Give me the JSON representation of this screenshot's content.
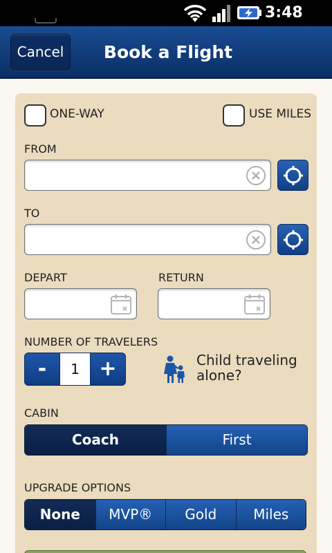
{
  "status_bar": {
    "time": "3:48 PM"
  },
  "header": {
    "cancel_label": "Cancel",
    "title": "Book a Flight"
  },
  "options": {
    "one_way_label": "ONE-WAY",
    "use_miles_label": "USE MILES"
  },
  "from": {
    "label": "FROM",
    "value": ""
  },
  "to": {
    "label": "TO",
    "value": ""
  },
  "dates": {
    "depart_label": "DEPART",
    "return_label": "RETURN"
  },
  "travelers": {
    "label": "NUMBER OF TRAVELERS",
    "minus_label": "-",
    "count": "1",
    "plus_label": "+",
    "child_line1": "Child traveling",
    "child_line2": "alone?"
  },
  "cabin": {
    "label": "CABIN",
    "options": [
      "Coach",
      "First"
    ],
    "selected": "Coach"
  },
  "upgrade": {
    "label": "UPGRADE OPTIONS",
    "options": [
      "None",
      "MVP®",
      "Gold",
      "Miles"
    ],
    "selected": "None"
  },
  "icons": {
    "clear": "clear-icon",
    "locate": "locate-icon",
    "calendar": "calendar-icon",
    "child": "child-icon"
  },
  "colors": {
    "header_blue": "#123e7e",
    "card_tan": "#ebdcbf",
    "button_blue": "#1e57a9",
    "selected_navy": "#0b1f45"
  }
}
